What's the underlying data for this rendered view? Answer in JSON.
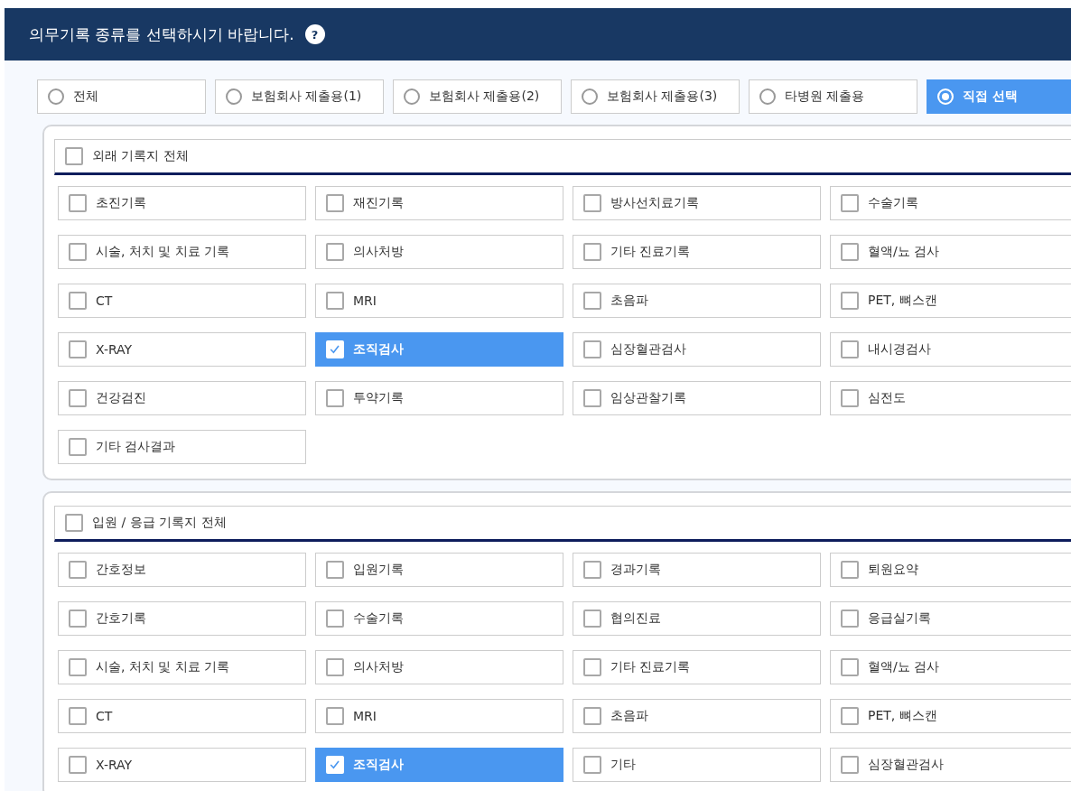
{
  "header": {
    "title": "의무기록 종류를 선택하시기 바랍니다.",
    "help": "?"
  },
  "record_types": [
    {
      "label": "전체",
      "selected": false
    },
    {
      "label": "보험회사 제출용(1)",
      "selected": false
    },
    {
      "label": "보험회사 제출용(2)",
      "selected": false
    },
    {
      "label": "보험회사 제출용(3)",
      "selected": false
    },
    {
      "label": "타병원 제출용",
      "selected": false
    },
    {
      "label": "직접 선택",
      "selected": true
    }
  ],
  "sections": [
    {
      "title": "외래 기록지 전체",
      "checked": false,
      "items": [
        {
          "label": "초진기록",
          "checked": false
        },
        {
          "label": "재진기록",
          "checked": false
        },
        {
          "label": "방사선치료기록",
          "checked": false
        },
        {
          "label": "수술기록",
          "checked": false
        },
        {
          "label": "시술, 처치 및 치료 기록",
          "checked": false
        },
        {
          "label": "의사처방",
          "checked": false
        },
        {
          "label": "기타 진료기록",
          "checked": false
        },
        {
          "label": "혈액/뇨 검사",
          "checked": false
        },
        {
          "label": "CT",
          "checked": false
        },
        {
          "label": "MRI",
          "checked": false
        },
        {
          "label": "초음파",
          "checked": false
        },
        {
          "label": "PET, 뼈스캔",
          "checked": false
        },
        {
          "label": "X-RAY",
          "checked": false
        },
        {
          "label": "조직검사",
          "checked": true
        },
        {
          "label": "심장혈관검사",
          "checked": false
        },
        {
          "label": "내시경검사",
          "checked": false
        },
        {
          "label": "건강검진",
          "checked": false
        },
        {
          "label": "투약기록",
          "checked": false
        },
        {
          "label": "임상관찰기록",
          "checked": false
        },
        {
          "label": "심전도",
          "checked": false
        },
        {
          "label": "기타 검사결과",
          "checked": false
        }
      ]
    },
    {
      "title": "입원 / 응급 기록지 전체",
      "checked": false,
      "items": [
        {
          "label": "간호정보",
          "checked": false
        },
        {
          "label": "입원기록",
          "checked": false
        },
        {
          "label": "경과기록",
          "checked": false
        },
        {
          "label": "퇴원요약",
          "checked": false
        },
        {
          "label": "간호기록",
          "checked": false
        },
        {
          "label": "수술기록",
          "checked": false
        },
        {
          "label": "협의진료",
          "checked": false
        },
        {
          "label": "응급실기록",
          "checked": false
        },
        {
          "label": "시술, 처치 및 치료 기록",
          "checked": false
        },
        {
          "label": "의사처방",
          "checked": false
        },
        {
          "label": "기타 진료기록",
          "checked": false
        },
        {
          "label": "혈액/뇨 검사",
          "checked": false
        },
        {
          "label": "CT",
          "checked": false
        },
        {
          "label": "MRI",
          "checked": false
        },
        {
          "label": "초음파",
          "checked": false
        },
        {
          "label": "PET, 뼈스캔",
          "checked": false
        },
        {
          "label": "X-RAY",
          "checked": false
        },
        {
          "label": "조직검사",
          "checked": true
        },
        {
          "label": "기타",
          "checked": false
        },
        {
          "label": "심장혈관검사",
          "checked": false
        }
      ]
    }
  ]
}
